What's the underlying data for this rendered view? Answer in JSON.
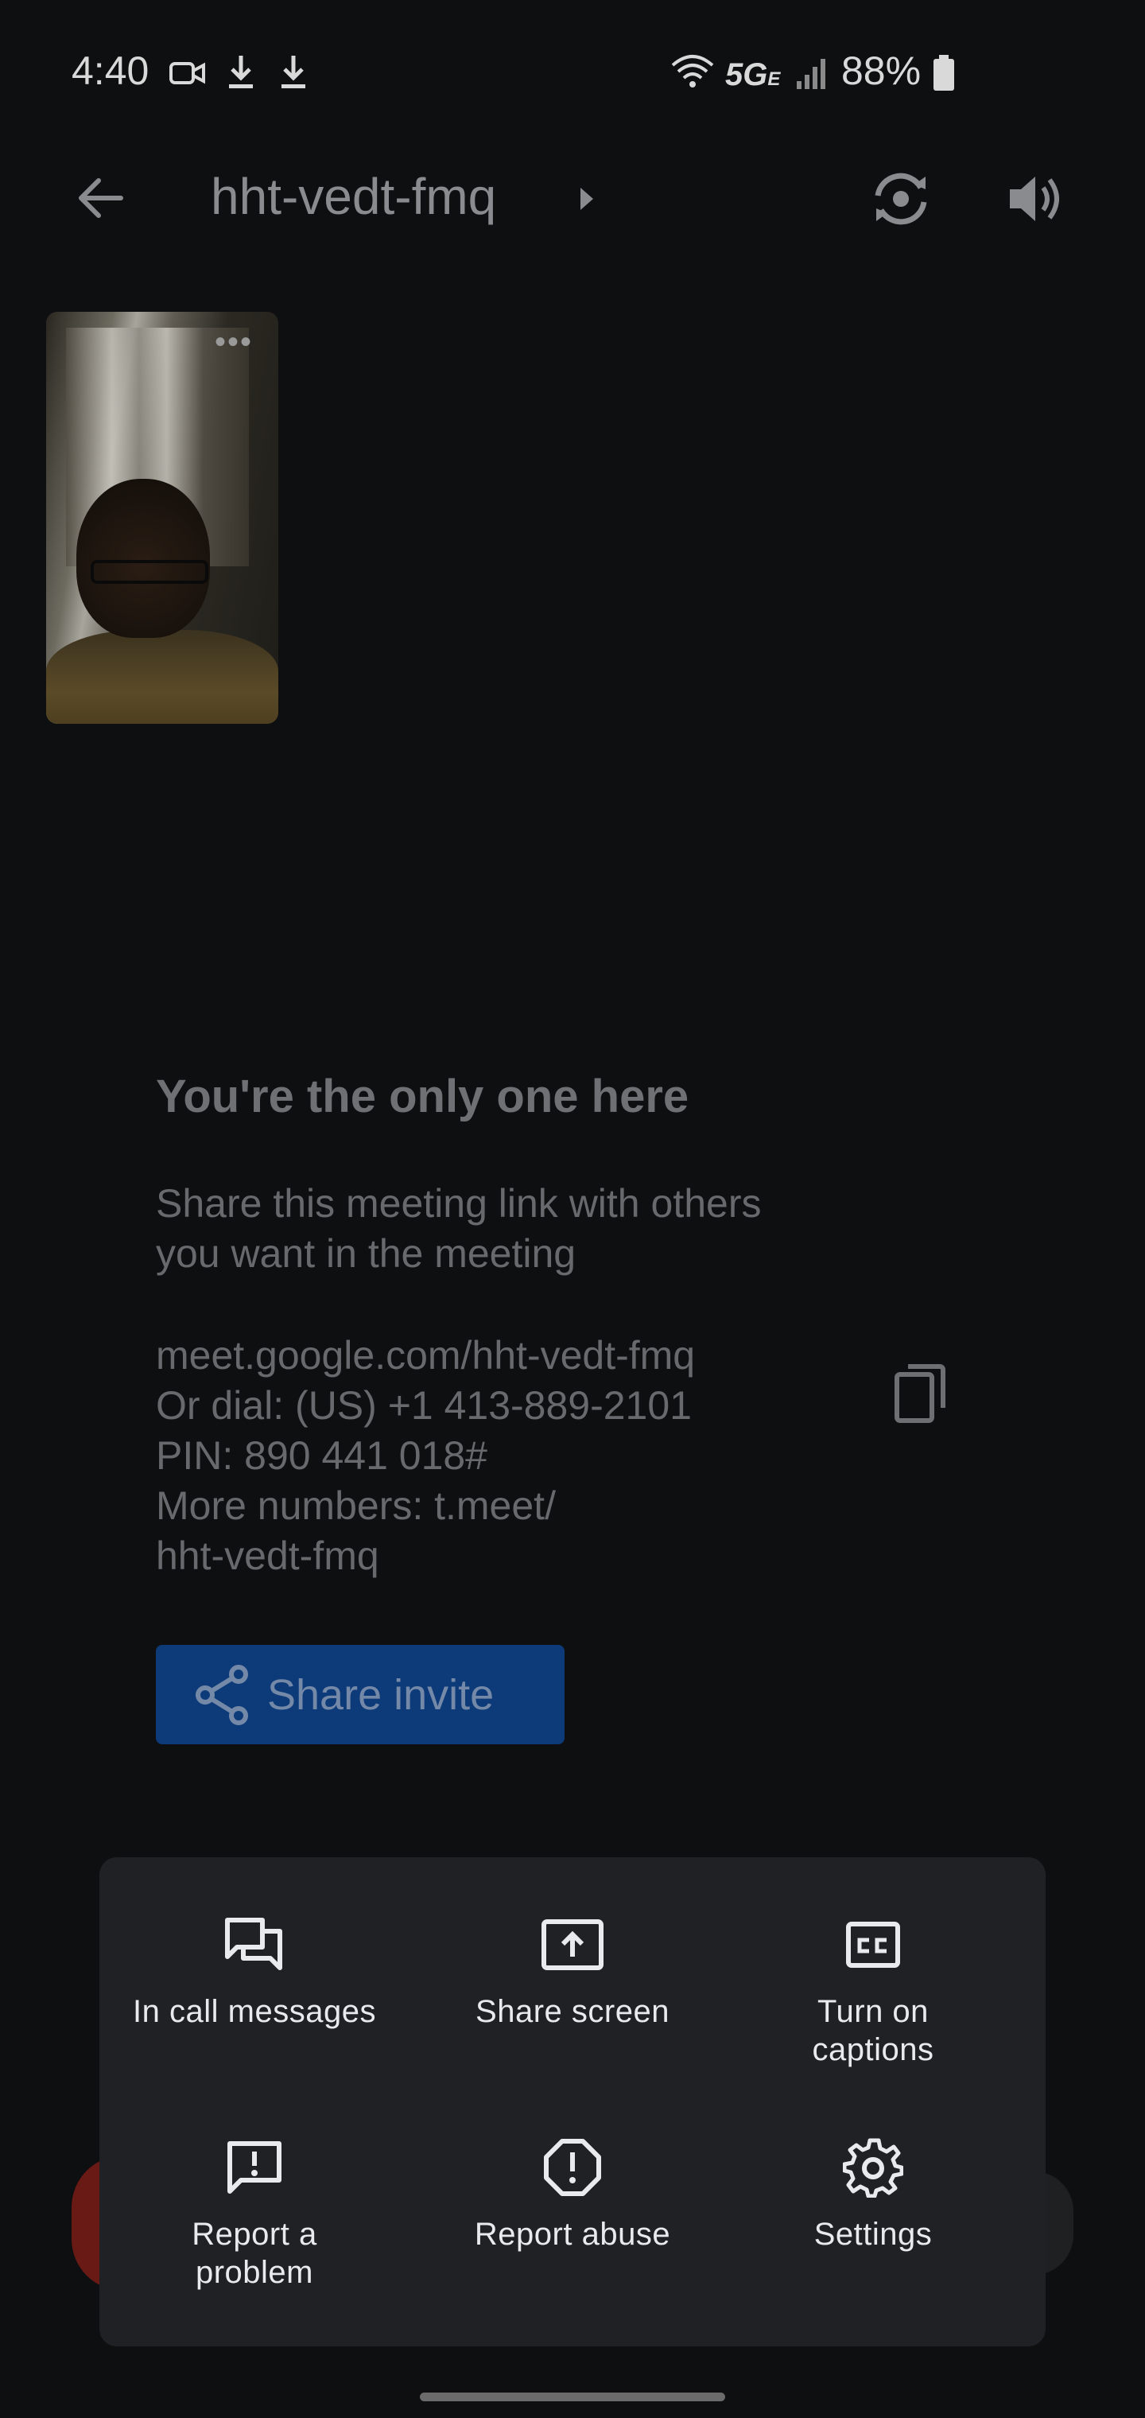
{
  "status_bar": {
    "time": "4:40",
    "network": "5G",
    "network_suffix": "E",
    "battery": "88%",
    "icons": [
      "video-camera-icon",
      "download-icon",
      "download-icon",
      "wifi-icon",
      "signal-icon",
      "battery-icon"
    ]
  },
  "toolbar": {
    "title": "hht-vedt-fmq",
    "icons": [
      "back-arrow-icon",
      "chevron-right-icon",
      "switch-camera-icon",
      "speaker-icon"
    ]
  },
  "self_tile": {
    "more_label": "•••"
  },
  "info": {
    "heading": "You're the only one here",
    "description_line1": "Share this meeting link with others",
    "description_line2": "you want in the meeting",
    "link": "meet.google.com/hht-vedt-fmq",
    "dial": "Or dial: (US) +1 413-889-2101",
    "pin": "PIN: 890 441 018#",
    "more_numbers_1": "More numbers: t.meet/",
    "more_numbers_2": "hht-vedt-fmq"
  },
  "share_button": {
    "label": "Share invite"
  },
  "menu": {
    "items": [
      {
        "label": "In call messages",
        "icon": "chat-icon"
      },
      {
        "label": "Share screen",
        "icon": "present-screen-icon"
      },
      {
        "label": "Turn on\ncaptions",
        "icon": "captions-icon"
      },
      {
        "label": "Report a\nproblem",
        "icon": "feedback-icon"
      },
      {
        "label": "Report abuse",
        "icon": "alert-circle-icon"
      },
      {
        "label": "Settings",
        "icon": "gear-icon"
      }
    ]
  },
  "colors": {
    "background": "#0e0f10",
    "sheet": "#202124",
    "share_button": "#0d3a78",
    "menu_text": "#e8eaed"
  }
}
